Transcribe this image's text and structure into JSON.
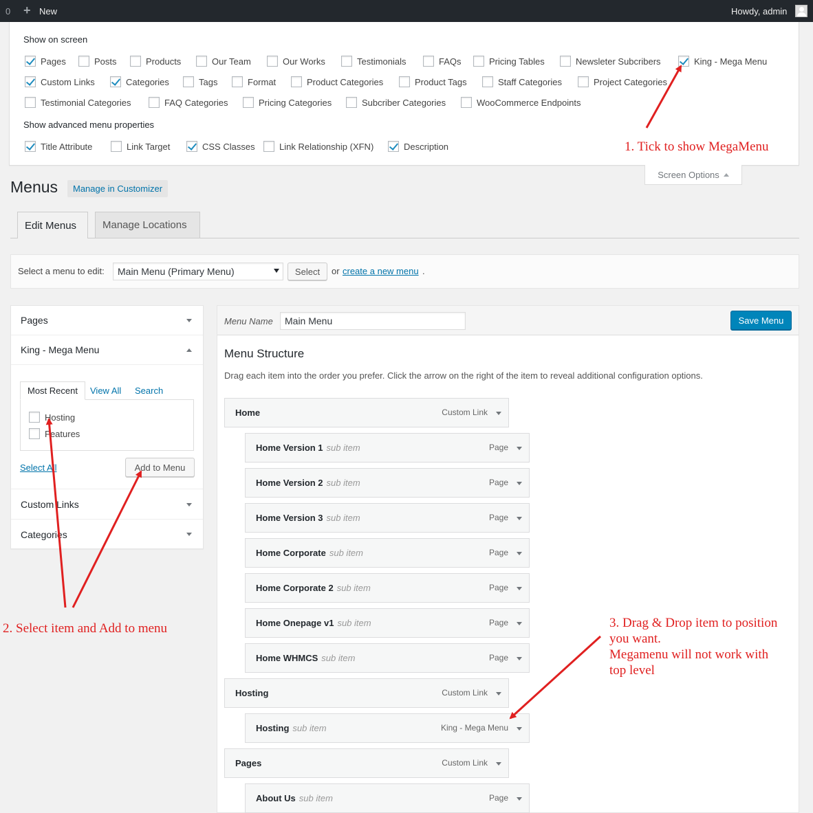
{
  "admin_bar": {
    "count": "0",
    "new_label": "New",
    "howdy": "Howdy, admin"
  },
  "screen_options": {
    "show_on_screen": "Show on screen",
    "rows": [
      [
        {
          "label": "Pages",
          "checked": true
        },
        {
          "label": "Posts",
          "checked": false
        },
        {
          "label": "Products",
          "checked": false
        },
        {
          "label": "Our Team",
          "checked": false
        },
        {
          "label": "Our Works",
          "checked": false
        },
        {
          "label": "Testimonials",
          "checked": false
        },
        {
          "label": "FAQs",
          "checked": false
        },
        {
          "label": "Pricing Tables",
          "checked": false
        },
        {
          "label": "Newsleter Subcribers",
          "checked": false
        },
        {
          "label": "King - Mega Menu",
          "checked": true
        }
      ],
      [
        {
          "label": "Custom Links",
          "checked": true
        },
        {
          "label": "Categories",
          "checked": true
        },
        {
          "label": "Tags",
          "checked": false
        },
        {
          "label": "Format",
          "checked": false
        },
        {
          "label": "Product Categories",
          "checked": false
        },
        {
          "label": "Product Tags",
          "checked": false
        },
        {
          "label": "Staff Categories",
          "checked": false
        },
        {
          "label": "Project Categories",
          "checked": false
        }
      ],
      [
        {
          "label": "Testimonial Categories",
          "checked": false
        },
        {
          "label": "FAQ Categories",
          "checked": false
        },
        {
          "label": "Pricing Categories",
          "checked": false
        },
        {
          "label": "Subcriber Categories",
          "checked": false
        },
        {
          "label": "WooCommerce Endpoints",
          "checked": false
        }
      ]
    ],
    "advanced_heading": "Show advanced menu properties",
    "advanced": [
      {
        "label": "Title Attribute",
        "checked": true
      },
      {
        "label": "Link Target",
        "checked": false
      },
      {
        "label": "CSS Classes",
        "checked": true
      },
      {
        "label": "Link Relationship (XFN)",
        "checked": false
      },
      {
        "label": "Description",
        "checked": true
      }
    ],
    "tab_label": "Screen Options"
  },
  "annotations": {
    "a1": "1. Tick to show MegaMenu",
    "a2": "2. Select item and Add to menu",
    "a3_1": "3. Drag & Drop item to position",
    "a3_2": "you want.",
    "a3_3": "Megamenu will not work with",
    "a3_4": "top level",
    "color": "#e02020"
  },
  "page": {
    "title": "Menus",
    "manage_customizer": "Manage in Customizer"
  },
  "tabs": {
    "edit": "Edit Menus",
    "locations": "Manage Locations"
  },
  "manage": {
    "label": "Select a menu to edit:",
    "selected": "Main Menu (Primary Menu)",
    "select_btn": "Select",
    "or": "or",
    "create_link": "create a new menu",
    "dot": "."
  },
  "left": {
    "pages": "Pages",
    "mega": "King - Mega Menu",
    "tabs": {
      "recent": "Most Recent",
      "all": "View All",
      "search": "Search"
    },
    "items": [
      {
        "label": "Hosting",
        "checked": false
      },
      {
        "label": "Features",
        "checked": false
      }
    ],
    "select_all": "Select All",
    "add_btn": "Add to Menu",
    "custom_links": "Custom Links",
    "categories": "Categories"
  },
  "right": {
    "menu_name_label": "Menu Name",
    "menu_name": "Main Menu",
    "save": "Save Menu",
    "structure_title": "Menu Structure",
    "structure_desc": "Drag each item into the order you prefer. Click the arrow on the right of the item to reveal additional configuration options.",
    "items": [
      {
        "title": "Home",
        "sub": "",
        "type": "Custom Link",
        "level": 0
      },
      {
        "title": "Home Version 1",
        "sub": "sub item",
        "type": "Page",
        "level": 1
      },
      {
        "title": "Home Version 2",
        "sub": "sub item",
        "type": "Page",
        "level": 1
      },
      {
        "title": "Home Version 3",
        "sub": "sub item",
        "type": "Page",
        "level": 1
      },
      {
        "title": "Home Corporate",
        "sub": "sub item",
        "type": "Page",
        "level": 1
      },
      {
        "title": "Home Corporate 2",
        "sub": "sub item",
        "type": "Page",
        "level": 1
      },
      {
        "title": "Home Onepage v1",
        "sub": "sub item",
        "type": "Page",
        "level": 1
      },
      {
        "title": "Home WHMCS",
        "sub": "sub item",
        "type": "Page",
        "level": 1
      },
      {
        "title": "Hosting",
        "sub": "",
        "type": "Custom Link",
        "level": 0
      },
      {
        "title": "Hosting",
        "sub": "sub item",
        "type": "King - Mega Menu",
        "level": 1
      },
      {
        "title": "Pages",
        "sub": "",
        "type": "Custom Link",
        "level": 0
      },
      {
        "title": "About Us",
        "sub": "sub item",
        "type": "Page",
        "level": 1
      }
    ]
  }
}
